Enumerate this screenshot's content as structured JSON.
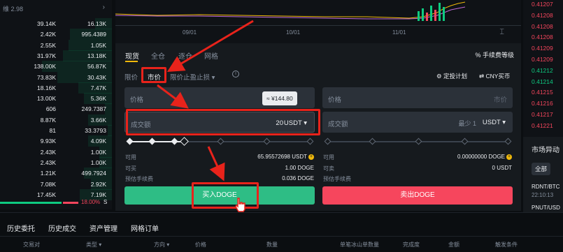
{
  "header": {
    "pair_price": "维 2.98",
    "chevron": "›"
  },
  "orderbook": [
    {
      "price": "39.14K",
      "amount": "16.13K"
    },
    {
      "price": "2.42K",
      "amount": "995.4389"
    },
    {
      "price": "2.55K",
      "amount": "1.05K"
    },
    {
      "price": "31.97K",
      "amount": "13.18K"
    },
    {
      "price": "138.00K",
      "amount": "56.87K"
    },
    {
      "price": "73.83K",
      "amount": "30.43K"
    },
    {
      "price": "18.16K",
      "amount": "7.47K"
    },
    {
      "price": "13.00K",
      "amount": "5.36K"
    },
    {
      "price": "606",
      "amount": "249.7387"
    },
    {
      "price": "8.87K",
      "amount": "3.66K"
    },
    {
      "price": "81",
      "amount": "33.3793"
    },
    {
      "price": "9.93K",
      "amount": "4.09K"
    },
    {
      "price": "2.43K",
      "amount": "1.00K"
    },
    {
      "price": "2.43K",
      "amount": "1.00K"
    },
    {
      "price": "1.21K",
      "amount": "499.7924"
    },
    {
      "price": "7.08K",
      "amount": "2.92K"
    },
    {
      "price": "17.45K",
      "amount": "7.19K"
    }
  ],
  "ratio": {
    "sell_pct": "18.00%",
    "s_label": "S"
  },
  "chart": {
    "dates": [
      "09/01",
      "10/01",
      "11/01"
    ]
  },
  "trade": {
    "tabs": [
      "现货",
      "全仓",
      "逐仓",
      "网格"
    ],
    "fee_label": "手续费等级",
    "order_types": {
      "limit": "限价",
      "market": "市价",
      "stop": "限价止盈止损 ▾"
    },
    "dca": "定投计划",
    "cny": "CNY买币",
    "buy": {
      "price_label": "价格",
      "tooltip": "≈ ¥144.80",
      "amount_label": "成交额",
      "amount_value": "20",
      "unit": "USDT ▾",
      "avail_k": "可用",
      "avail_v": "65.95572698 USDT",
      "can_k": "可买",
      "can_v": "1.00 DOGE",
      "fee_k": "预估手续费",
      "fee_v": "0.036 DOGE",
      "button": "买入DOGE"
    },
    "sell": {
      "price_label": "价格",
      "price_placeholder": "市价",
      "amount_label": "成交额",
      "min_label": "最少 1",
      "unit": "USDT ▾",
      "avail_k": "可用",
      "avail_v": "0.00000000 DOGE",
      "can_k": "可卖",
      "can_v": "0 USDT",
      "fee_k": "预估手续费",
      "button": "卖出DOGE"
    }
  },
  "right_prices": [
    "0.41207",
    "0.41208",
    "0.41208",
    "0.41208",
    "0.41209",
    "0.41209",
    "0.41212",
    "0.41214",
    "0.41215",
    "0.41216",
    "0.41217",
    "0.41221"
  ],
  "right_price_colors": [
    "#f6465d",
    "#f6465d",
    "#f6465d",
    "#f6465d",
    "#f6465d",
    "#f6465d",
    "#0ecb81",
    "#0ecb81",
    "#f6465d",
    "#f6465d",
    "#f6465d",
    "#f6465d"
  ],
  "market_moves": {
    "title": "市场异动",
    "all": "全部",
    "items": [
      {
        "pair": "RDNT/BTC",
        "time": "22:10:13"
      },
      {
        "pair": "PNUT/USD",
        "time": ""
      }
    ]
  },
  "bottom": {
    "tabs": [
      "历史委托",
      "历史成交",
      "资产管理",
      "网格订单"
    ],
    "headers": [
      "交易对",
      "类型 ▾",
      "方向 ▾",
      "价格",
      "数量",
      "单笔冰山单数量",
      "完成度",
      "金额",
      "触发条件"
    ]
  },
  "colors": {
    "buy": "#2ebd85",
    "sell": "#f6465d",
    "accent": "#f0b90b",
    "annotation": "#e8231b"
  }
}
